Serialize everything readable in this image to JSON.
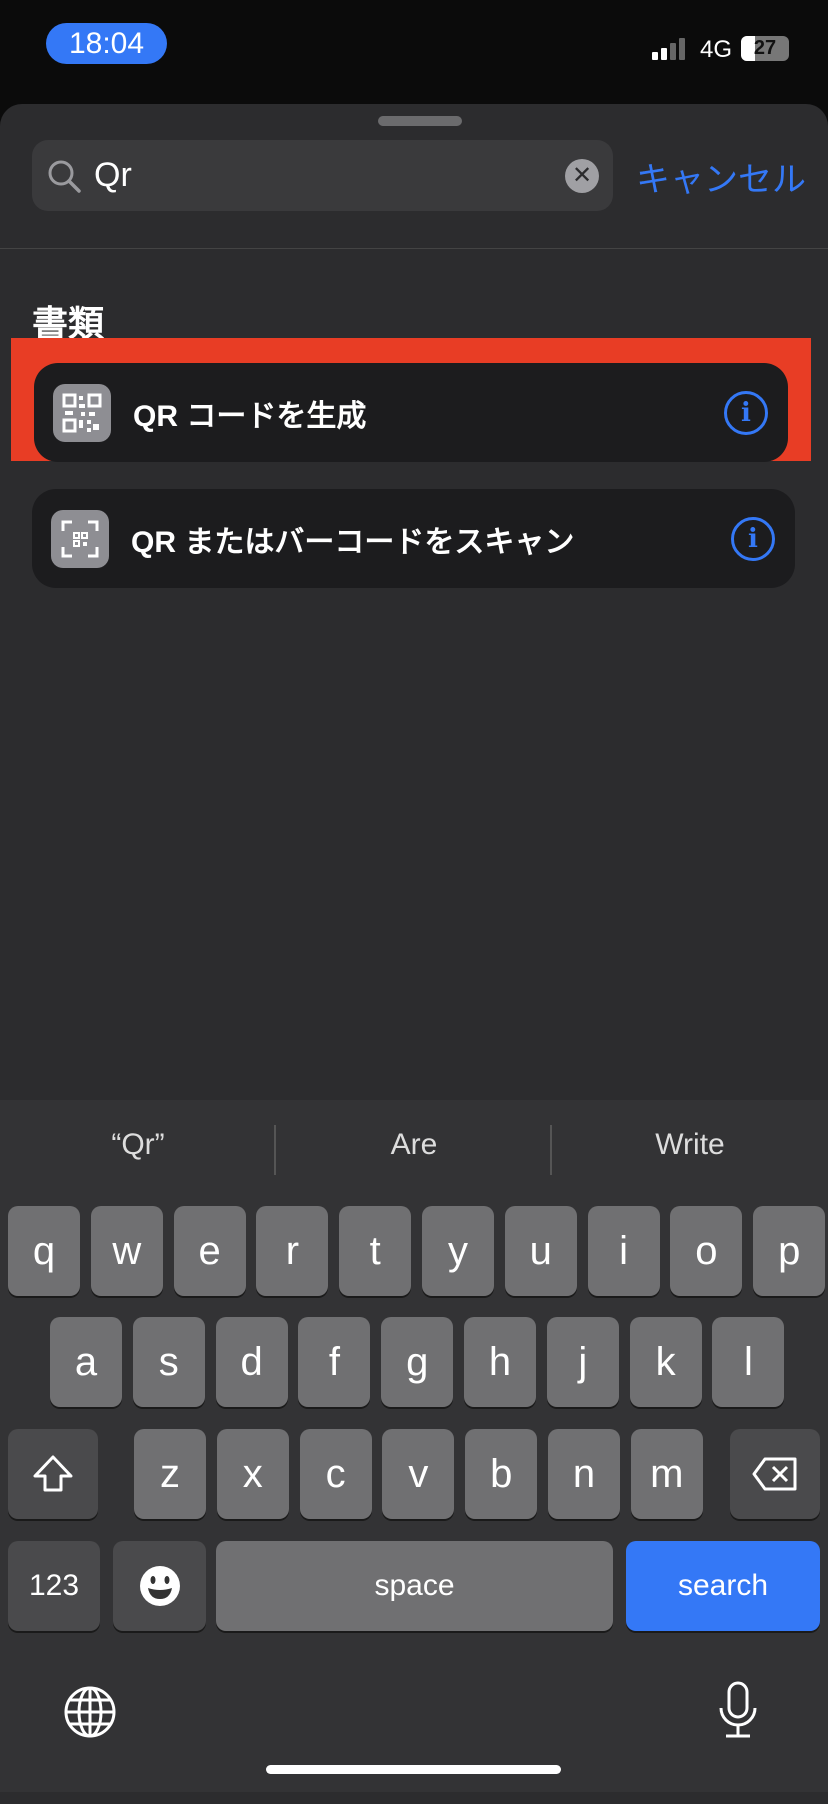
{
  "status": {
    "time": "18:04",
    "network": "4G",
    "battery": "27"
  },
  "search": {
    "value": "Qr",
    "cancel": "キャンセル"
  },
  "section_header": "書類",
  "results": [
    {
      "label": "QR コードを生成",
      "icon": "qr-code-icon",
      "highlighted": true
    },
    {
      "label": "QR またはバーコードをスキャン",
      "icon": "qr-scan-icon",
      "highlighted": false
    }
  ],
  "highlight_color": "#e83d25",
  "accent_color": "#3478f6",
  "keyboard": {
    "suggestions": [
      "“Qr”",
      "Are",
      "Write"
    ],
    "row1": [
      "q",
      "w",
      "e",
      "r",
      "t",
      "y",
      "u",
      "i",
      "o",
      "p"
    ],
    "row2": [
      "a",
      "s",
      "d",
      "f",
      "g",
      "h",
      "j",
      "k",
      "l"
    ],
    "row3": [
      "z",
      "x",
      "c",
      "v",
      "b",
      "n",
      "m"
    ],
    "numbers": "123",
    "space": "space",
    "search": "search"
  }
}
